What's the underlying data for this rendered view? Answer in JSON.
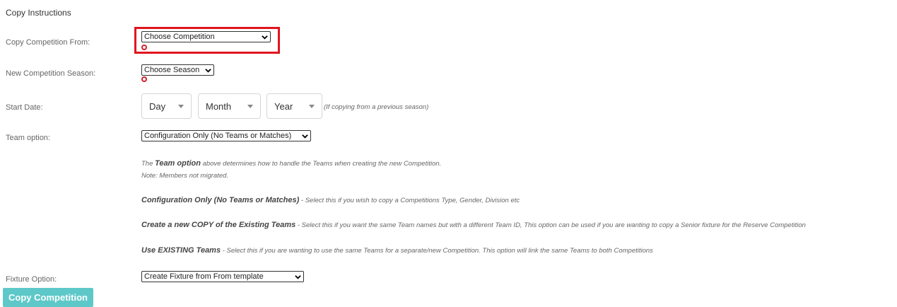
{
  "section_title": "Copy Instructions",
  "fields": {
    "copy_from": {
      "label": "Copy Competition From:",
      "value": "Choose Competition"
    },
    "season": {
      "label": "New Competition Season:",
      "value": "Choose Season"
    },
    "start_date": {
      "label": "Start Date:",
      "day": "Day",
      "month": "Month",
      "year": "Year",
      "hint": "(If copying from a previous season)"
    },
    "team_option": {
      "label": "Team option:",
      "value": "Configuration Only (No Teams or Matches)"
    },
    "fixture_option": {
      "label": "Fixture Option:",
      "value": "Create Fixture from From template"
    }
  },
  "descriptions": {
    "intro_pre": "The ",
    "intro_bold": "Team option",
    "intro_post": " above determines how to handle the Teams when creating the new Competition.",
    "note": "Note: Members not migrated.",
    "config_bold": "Configuration Only (No Teams or Matches)",
    "config_text": " - Select this if you wish to copy a Competitions Type, Gender, Division etc",
    "copy_bold": "Create a new COPY of the Existing Teams",
    "copy_text": " - Select this if you want the same Team names but with a different Team ID, This option can be used if you are wanting to copy a Senior fixture for the Reserve Competition",
    "existing_bold": "Use EXISTING Teams",
    "existing_text": " - Select this if you are wanting to use the same Teams for a separate/new Competition. This option will link the same Teams to both Competitions"
  },
  "button": {
    "label": "Copy Competition"
  },
  "colors": {
    "accent": "#5ec8c9",
    "highlight": "#e1141f",
    "required": "#d41f2b"
  },
  "icons": {
    "dropdown": "chevron-down-icon",
    "required": "required-circle-icon"
  }
}
